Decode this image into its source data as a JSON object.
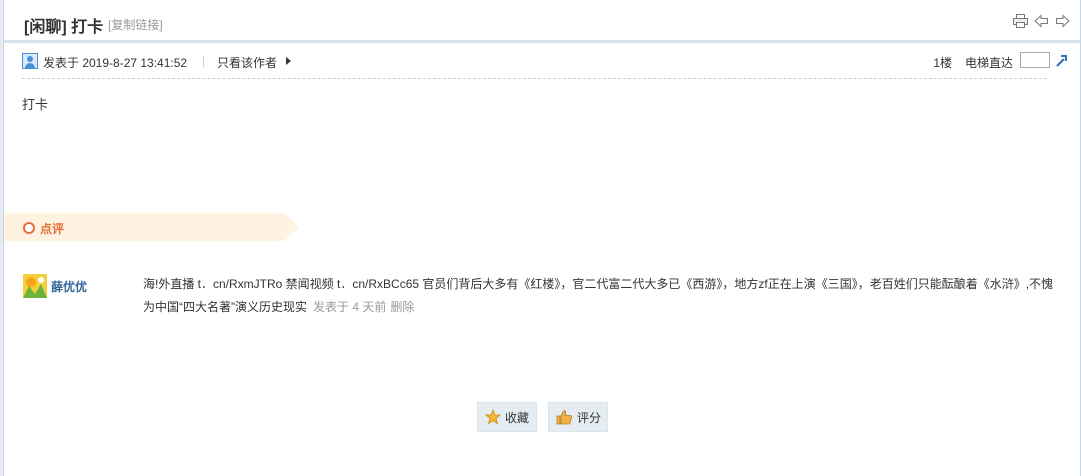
{
  "thread": {
    "title": "[闲聊] 打卡",
    "copy_link": "[复制链接]"
  },
  "title_icons": [
    "print-icon",
    "previous-thread-icon",
    "next-thread-icon"
  ],
  "post": {
    "time": "发表于 2019-8-27 13:41:52",
    "separator": "|",
    "author_only": "只看该作者",
    "floor": "1楼",
    "jump_label": "电梯直达",
    "jump_value": "",
    "content": "打卡"
  },
  "comments": {
    "label": "点评",
    "items": [
      {
        "user": "薛优优",
        "text": "海!外直播 t．cn/RxmJTRo 禁闻视频 t．cn/RxBCc65 官员们背后大多有《红楼》，官二代富二代大多已《西游》，地方zf正在上演《三国》，老百姓们只能酝酿着《水浒》,不愧为中国“四大名著”演义历史现实",
        "time": "发表于 4 天前",
        "delete": "删除"
      }
    ]
  },
  "actions": {
    "favorite": "收藏",
    "rate": "评分"
  },
  "colors": {
    "accent": "#e76d3a",
    "username": "#336699",
    "button_bg": "#e5edf2",
    "comment_header_bg": "#fdf3e0"
  }
}
